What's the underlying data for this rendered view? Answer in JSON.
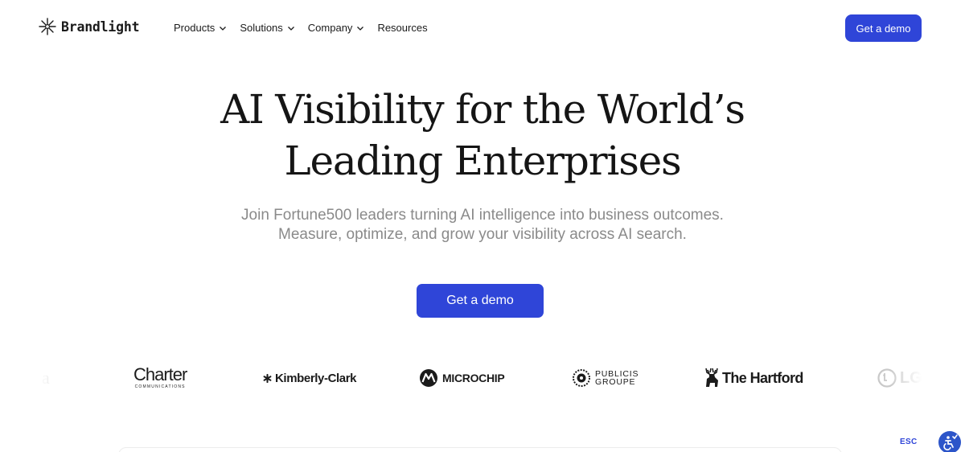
{
  "brand": {
    "name": "Brandlight"
  },
  "nav": {
    "items": [
      {
        "label": "Products",
        "has_dropdown": true
      },
      {
        "label": "Solutions",
        "has_dropdown": true
      },
      {
        "label": "Company",
        "has_dropdown": true
      },
      {
        "label": "Resources",
        "has_dropdown": false
      }
    ],
    "cta_label": "Get a demo"
  },
  "hero": {
    "title_line1": "AI Visibility for the World’s",
    "title_line2": "Leading Enterprises",
    "subtitle_line1": "Join Fortune500 leaders turning AI intelligence into business outcomes.",
    "subtitle_line2": "Measure, optimize, and grow your visibility across AI search.",
    "cta_label": "Get a demo"
  },
  "customer_logos": {
    "partial_left": "a",
    "charter": {
      "name": "Charter",
      "tagline": "COMMUNICATIONS"
    },
    "kimberly_clark": "Kimberly-Clark",
    "microchip": "MICROCHIP",
    "publicis": {
      "line1": "PUBLICIS",
      "line2": "GROUPE"
    },
    "hartford": "The Hartford",
    "partial_right": "LG"
  },
  "accessibility": {
    "esc_label": "ESC"
  },
  "colors": {
    "accent": "#2f45d8",
    "text": "#151515",
    "muted": "#8a8a8a",
    "a11y_badge": "#2c55c9"
  },
  "icons": [
    "brandlight-star-icon",
    "chevron-down-icon",
    "accessibility-icon"
  ]
}
